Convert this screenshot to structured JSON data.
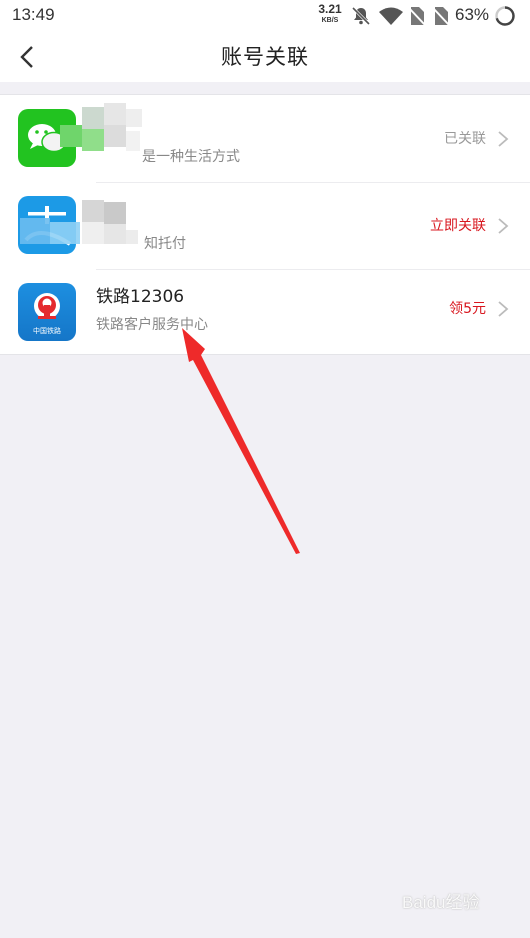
{
  "status_bar": {
    "time": "13:49",
    "net_speed_value": "3.21",
    "net_speed_unit": "KB/S",
    "battery": "63%",
    "icons": [
      "bell-off-icon",
      "wifi-icon",
      "no-sim-icon",
      "no-sim-icon",
      "battery-ring-icon"
    ]
  },
  "nav": {
    "back_icon": "chevron-left-icon",
    "title": "账号关联"
  },
  "accounts": [
    {
      "icon": "wechat-icon",
      "title": "",
      "subtitle": "是一种生活方式",
      "action": "已关联",
      "action_color": "#999999"
    },
    {
      "icon": "alipay-icon",
      "title": "",
      "subtitle": "知托付",
      "action": "立即关联",
      "action_color": "#d8171f"
    },
    {
      "icon": "railway-12306-icon",
      "icon_label": "中国铁路",
      "title": "铁路12306",
      "subtitle": "铁路客户服务中心",
      "action": "领5元",
      "action_color": "#d8171f"
    }
  ],
  "annotation": "red-arrow-pointer",
  "watermark": "Baidu经验"
}
